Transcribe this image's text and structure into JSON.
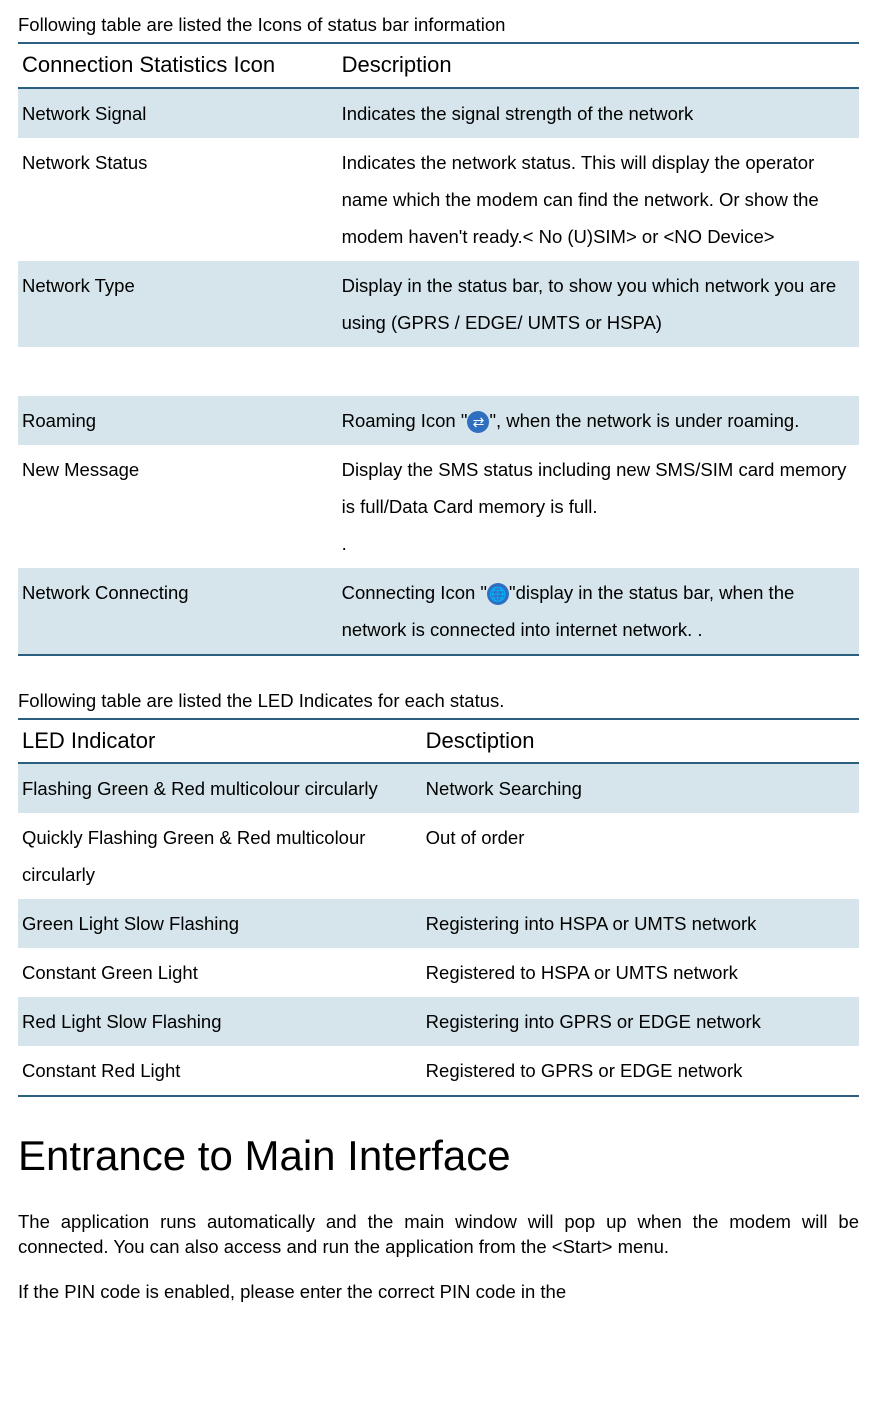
{
  "intro1": "Following table are listed the Icons of status bar information",
  "table1": {
    "head": [
      "Connection Statistics Icon",
      "Description"
    ],
    "rows": [
      {
        "a": "Network Signal",
        "b": "Indicates the signal strength of the network"
      },
      {
        "a": "Network Status",
        "b": "Indicates the network status. This will display the operator name which the modem can find the network. Or show the modem haven't ready.< No (U)SIM> or <NO Device>"
      },
      {
        "a": "Network Type",
        "b": "Display in the status bar, to show you which network you are using (GPRS / EDGE/ UMTS or HSPA)"
      },
      {
        "a": "",
        "b": ""
      },
      {
        "a": "Roaming",
        "b_pre": "Roaming Icon \"",
        "b_icon": "roaming",
        "b_post": "\", when the network is under roaming."
      },
      {
        "a": "New Message",
        "b": "Display the SMS status including new SMS/SIM card  memory is full/Data Card memory is full.\n."
      },
      {
        "a": "Network Connecting",
        "b_pre": "Connecting Icon \"",
        "b_icon": "connect",
        "b_post": "\"display in the status bar, when the network is connected into internet network. ."
      }
    ]
  },
  "intro2": "Following table are listed the LED Indicates for each status.",
  "table2": {
    "head": [
      "LED Indicator",
      "Desctiption"
    ],
    "rows": [
      {
        "a": "Flashing Green & Red multicolour circularly",
        "b": "Network Searching"
      },
      {
        "a": "Quickly Flashing Green & Red multicolour circularly",
        "b": "Out of order"
      },
      {
        "a": "Green Light Slow Flashing",
        "b": "Registering into HSPA or UMTS network"
      },
      {
        "a": "Constant Green Light",
        "b": "Registered to HSPA or UMTS network"
      },
      {
        "a": "Red Light Slow Flashing",
        "b": "Registering into GPRS or EDGE network"
      },
      {
        "a": "Constant Red Light",
        "b": "Registered to GPRS or EDGE network"
      }
    ]
  },
  "heading": "Entrance to Main Interface",
  "para1": "The application runs automatically and the main window will pop up when the modem will be connected. You can also access and run the application from the <Start> menu.",
  "para2": "If the PIN code is enabled, please enter the correct PIN code in the"
}
